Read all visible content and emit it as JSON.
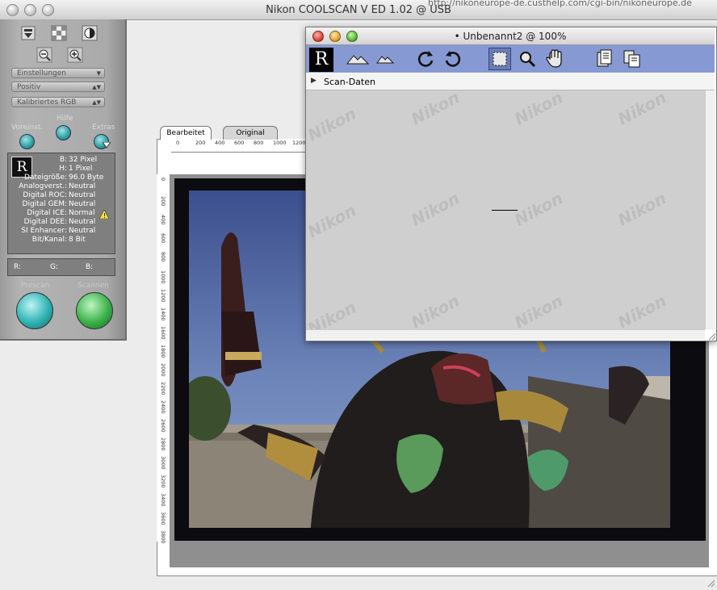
{
  "app": {
    "title": "Nikon COOLSCAN V ED 1.02 @ USB",
    "url_fragment": "http://nikoneurope-de.custhelp.com/cgi-bin/nikoneurope.de"
  },
  "palette": {
    "dropdowns": [
      "Einstellungen",
      "Positiv",
      "Kalibriertes RGB"
    ],
    "labels": {
      "voreinst": "Voreinst.",
      "hilfe": "Hilfe",
      "extras": "Extras"
    },
    "info": [
      {
        "key": "B",
        "value": "32 Pixel"
      },
      {
        "key": "H",
        "value": "1 Pixel"
      },
      {
        "key": "Dateigröße",
        "value": "96.0 Byte"
      },
      {
        "key": "Analogverst.",
        "value": "Neutral"
      },
      {
        "key": "Digital ROC",
        "value": "Neutral"
      },
      {
        "key": "Digital GEM",
        "value": "Neutral"
      },
      {
        "key": "Digital ICE",
        "value": "Normal"
      },
      {
        "key": "Digital DEE",
        "value": "Neutral"
      },
      {
        "key": "SI Enhancer",
        "value": "Neutral"
      },
      {
        "key": "Bit/Kanal",
        "value": "8 Bit"
      }
    ],
    "rgb": {
      "r": "R:",
      "g": "G:",
      "b": "B:"
    },
    "buttons": {
      "prescan": "Prescan",
      "scannen": "Scannen"
    }
  },
  "preview": {
    "tabs": [
      "Bearbeitet",
      "Original"
    ],
    "ruler_top": [
      "0",
      "200",
      "400",
      "600",
      "800",
      "1000",
      "1200"
    ],
    "ruler_left": [
      "0",
      "200",
      "400",
      "600",
      "800",
      "1000",
      "1200",
      "1400",
      "1600",
      "1800",
      "2000",
      "2200",
      "2400",
      "2600",
      "2800",
      "3000",
      "3200",
      "3400",
      "3600",
      "3800"
    ]
  },
  "scan_window": {
    "title": "• Unbenannt2 @ 100%",
    "toolbar_r": "R",
    "scan_data_label": "Scan-Daten",
    "watermark": "Nikon"
  },
  "colors": {
    "toolbar_blue": "#8799d2",
    "prescan_teal": "#2fb3b3",
    "scan_green": "#3bb24a"
  }
}
